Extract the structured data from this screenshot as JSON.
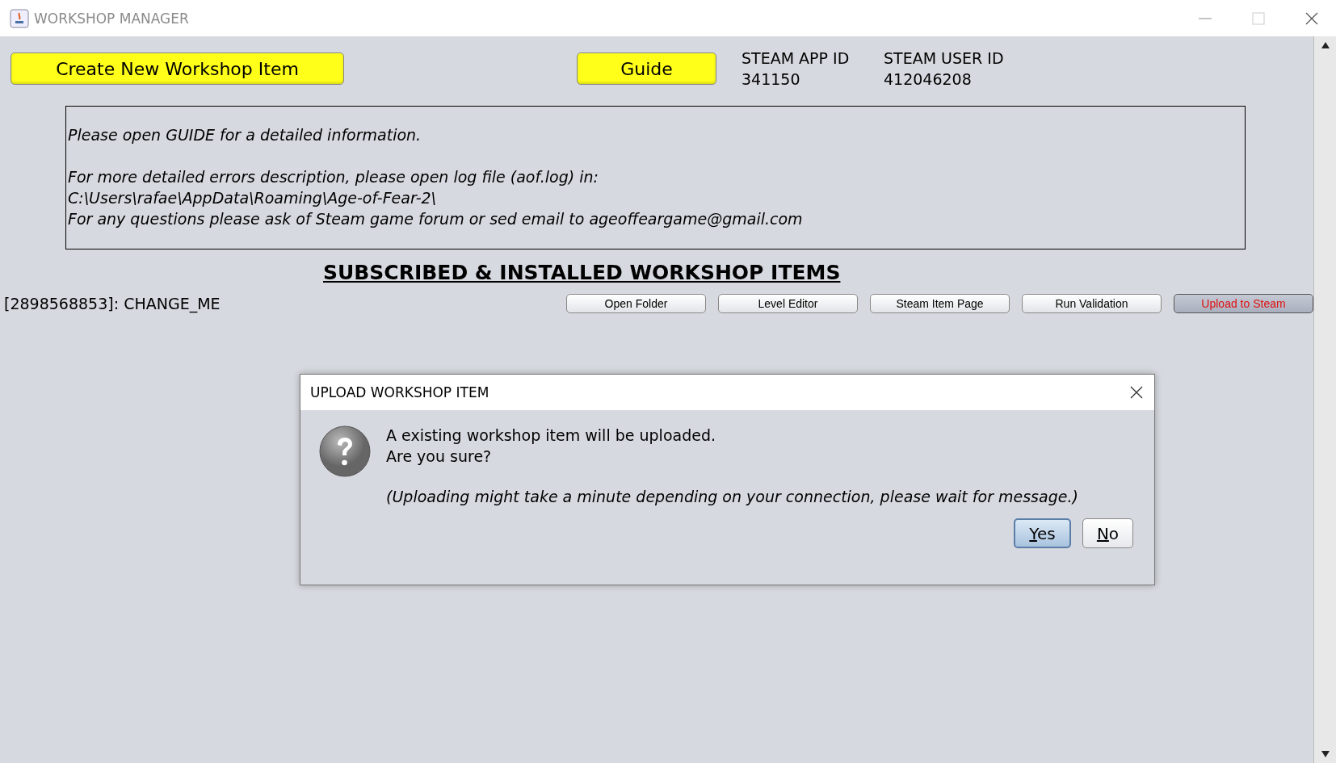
{
  "window": {
    "title": "WORKSHOP MANAGER"
  },
  "toolbar": {
    "create_button": "Create New Workshop Item",
    "guide_button": "Guide",
    "ids": [
      {
        "label": "STEAM APP ID",
        "value": "341150"
      },
      {
        "label": "STEAM USER ID",
        "value": "412046208"
      }
    ]
  },
  "info": {
    "paragraphs": [
      [
        "Please open GUIDE for a detailed information."
      ],
      [
        "For more detailed errors description, please open log file (aof.log) in:",
        "C:\\Users\\rafae\\AppData\\Roaming\\Age-of-Fear-2\\",
        "For any questions please ask of Steam game forum or sed email to ageoffeargame@gmail.com"
      ]
    ]
  },
  "section_title": "SUBSCRIBED & INSTALLED WORKSHOP ITEMS",
  "items": [
    {
      "name": "[2898568853]: CHANGE_ME",
      "actions": [
        {
          "label": "Open Folder",
          "selected": false
        },
        {
          "label": "Level Editor",
          "selected": false
        },
        {
          "label": "Steam Item Page",
          "selected": false
        },
        {
          "label": "Run Validation",
          "selected": false
        },
        {
          "label": "Upload to Steam",
          "selected": true
        }
      ]
    }
  ],
  "dialog": {
    "title": "UPLOAD WORKSHOP ITEM",
    "message": [
      "A existing workshop item will be uploaded.",
      "Are you sure?"
    ],
    "note": "(Uploading might take a minute depending on your connection, please wait for message.)",
    "buttons": [
      {
        "label": "Yes",
        "focused": true
      },
      {
        "label": "No",
        "focused": false
      }
    ]
  }
}
